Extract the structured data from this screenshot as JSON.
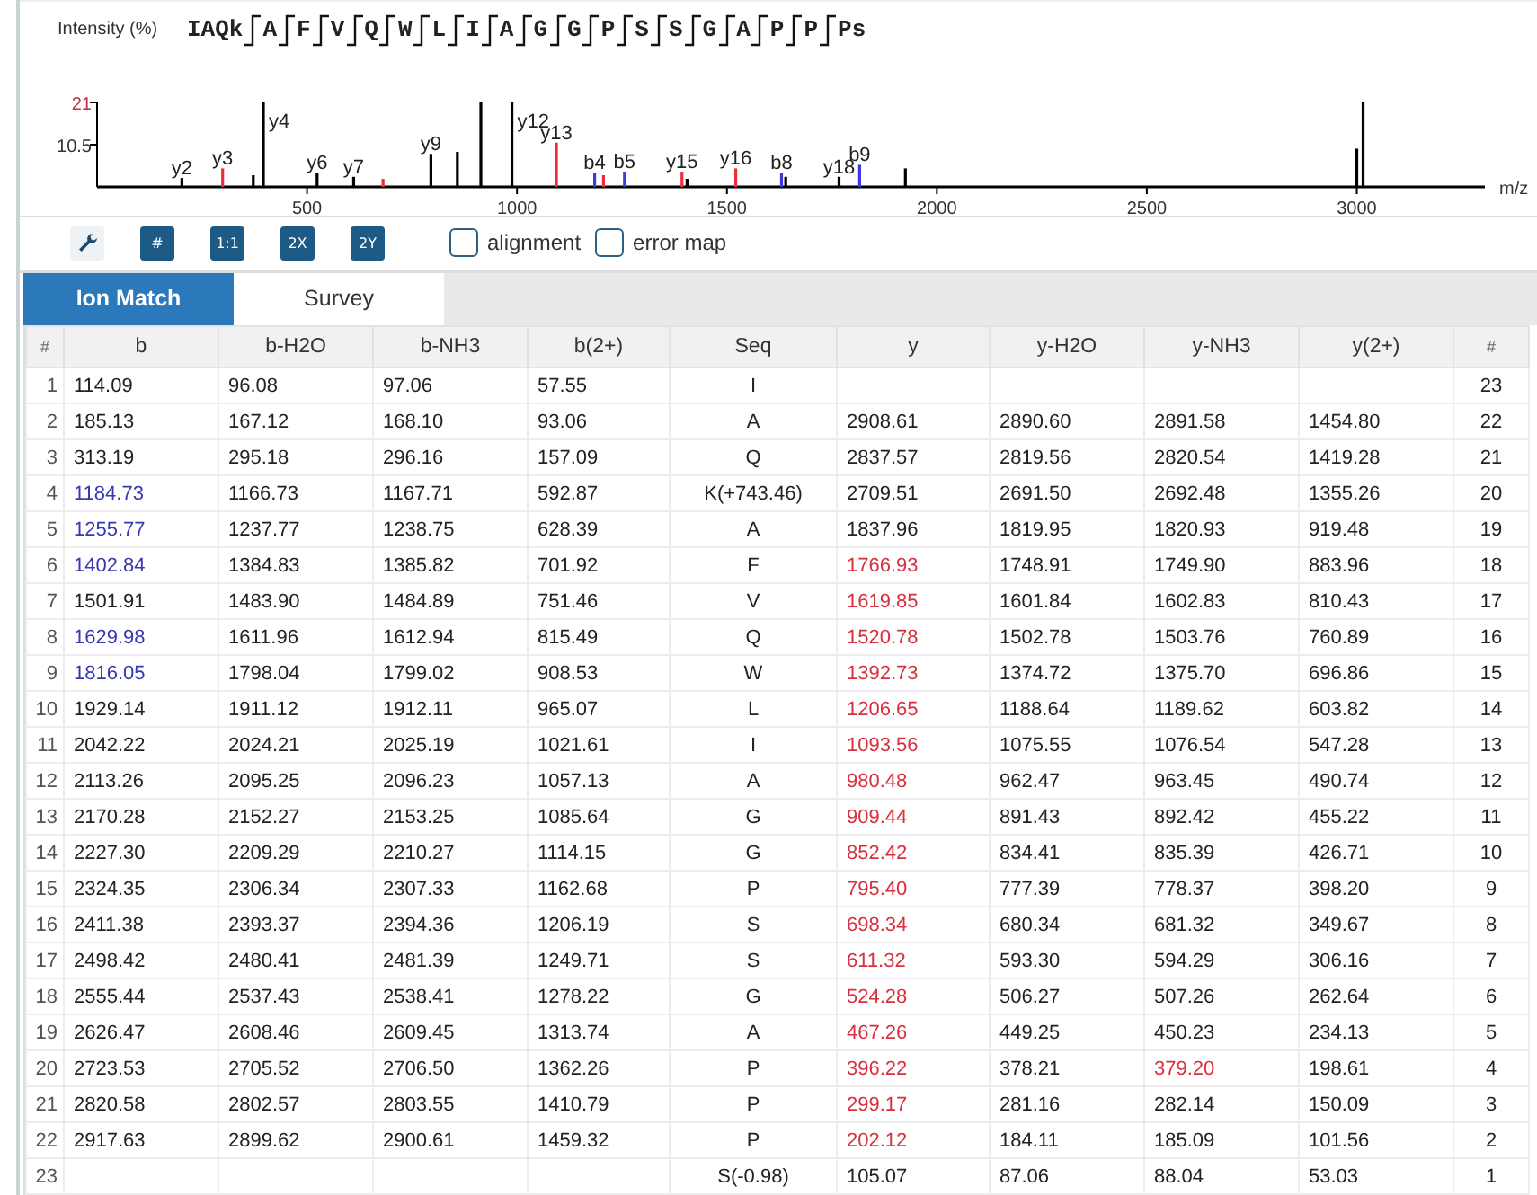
{
  "spectrum": {
    "sequence": [
      {
        "text": "IAQk",
        "break_after": true
      },
      {
        "text": "A",
        "break_after": true
      },
      {
        "text": "F",
        "break_after": true
      },
      {
        "text": "V",
        "break_after": true
      },
      {
        "text": "Q",
        "break_after": true
      },
      {
        "text": "W",
        "break_after": true
      },
      {
        "text": "L",
        "break_after": true
      },
      {
        "text": "I",
        "break_after": true
      },
      {
        "text": "A",
        "break_after": true
      },
      {
        "text": "G",
        "break_after": true
      },
      {
        "text": "G",
        "break_after": true
      },
      {
        "text": "P",
        "break_after": true
      },
      {
        "text": "S",
        "break_after": true
      },
      {
        "text": "S",
        "break_after": true
      },
      {
        "text": "G",
        "break_after": true
      },
      {
        "text": "A",
        "break_after": true
      },
      {
        "text": "P",
        "break_after": true
      },
      {
        "text": "P",
        "break_after": true
      },
      {
        "text": "Ps",
        "break_after": false
      }
    ],
    "chart_data": {
      "type": "bar",
      "ylabel": "Intensity (%)",
      "xlabel": "m/z",
      "xlim": [
        0,
        3305
      ],
      "ylim": [
        0,
        21
      ],
      "xticks": [
        500,
        1000,
        1500,
        2000,
        2500,
        3000
      ],
      "yticks": [
        10.5,
        21
      ],
      "x": [
        202,
        299,
        372,
        396,
        524,
        611,
        681,
        795,
        858,
        914,
        988,
        1094,
        1185,
        1206,
        1256,
        1393,
        1405,
        1521,
        1630,
        1640,
        1767,
        1816,
        1925,
        3000,
        3015
      ],
      "series": [
        {
          "color": "#000000",
          "values": [
            2.2,
            null,
            2.9,
            21,
            3.5,
            2.5,
            null,
            8.2,
            8.7,
            21,
            21,
            null,
            null,
            null,
            null,
            null,
            2.0,
            null,
            null,
            2.5,
            2.5,
            null,
            4.6,
            9.5,
            21
          ]
        },
        {
          "color": "#e8303a",
          "values": [
            null,
            4.6,
            null,
            null,
            null,
            null,
            2.0,
            null,
            null,
            null,
            null,
            11,
            null,
            2.9,
            null,
            3.8,
            null,
            4.6,
            null,
            null,
            null,
            null,
            null,
            null,
            null
          ]
        },
        {
          "color": "#3a3ae0",
          "values": [
            null,
            null,
            null,
            null,
            null,
            null,
            null,
            null,
            null,
            null,
            null,
            null,
            3.5,
            null,
            3.8,
            null,
            null,
            null,
            3.5,
            null,
            null,
            5.5,
            null,
            null,
            null
          ]
        }
      ],
      "annotations": [
        {
          "x": 202,
          "y": 2.2,
          "text": "y2"
        },
        {
          "x": 299,
          "y": 4.6,
          "text": "y3"
        },
        {
          "x": 396,
          "y": 21,
          "text": "y4"
        },
        {
          "x": 524,
          "y": 3.5,
          "text": "y6"
        },
        {
          "x": 611,
          "y": 2.5,
          "text": "y7"
        },
        {
          "x": 795,
          "y": 8.2,
          "text": "y9"
        },
        {
          "x": 988,
          "y": 21,
          "text": "y12"
        },
        {
          "x": 1094,
          "y": 11,
          "text": "y13"
        },
        {
          "x": 1185,
          "y": 3.5,
          "text": "b4"
        },
        {
          "x": 1256,
          "y": 3.8,
          "text": "b5"
        },
        {
          "x": 1393,
          "y": 3.8,
          "text": "y15"
        },
        {
          "x": 1521,
          "y": 4.6,
          "text": "y16"
        },
        {
          "x": 1630,
          "y": 3.5,
          "text": "b8"
        },
        {
          "x": 1767,
          "y": 2.5,
          "text": "y18"
        },
        {
          "x": 1816,
          "y": 5.5,
          "text": "b9"
        }
      ]
    }
  },
  "toolbar": {
    "buttons": [
      {
        "kind": "wrench"
      },
      {
        "kind": "text",
        "label": "#"
      },
      {
        "kind": "text",
        "label": "1:1"
      },
      {
        "kind": "text",
        "label": "2X"
      },
      {
        "kind": "text",
        "label": "2Y"
      }
    ],
    "checkboxes": [
      {
        "label": "alignment",
        "checked": false
      },
      {
        "label": "error map",
        "checked": false
      }
    ]
  },
  "tabs": [
    {
      "label": "Ion Match",
      "selected": true
    },
    {
      "label": "Survey",
      "selected": false
    }
  ],
  "table": {
    "columns": [
      "#",
      "b",
      "b-H2O",
      "b-NH3",
      "b(2+)",
      "Seq",
      "y",
      "y-H2O",
      "y-NH3",
      "y(2+)",
      "#"
    ],
    "rows": [
      {
        "cells": [
          "1",
          "114.09",
          "96.08",
          "97.06",
          "57.55",
          "I",
          null,
          null,
          null,
          null,
          "23"
        ],
        "b_matched": false
      },
      {
        "cells": [
          "2",
          "185.13",
          "167.12",
          "168.10",
          "93.06",
          "A",
          "2908.61",
          "2890.60",
          "2891.58",
          "1454.80",
          "22"
        ],
        "b_matched": false,
        "y_matched": false,
        "y_nh3_matched": false
      },
      {
        "cells": [
          "3",
          "313.19",
          "295.18",
          "296.16",
          "157.09",
          "Q",
          "2837.57",
          "2819.56",
          "2820.54",
          "1419.28",
          "21"
        ],
        "b_matched": false,
        "y_matched": false,
        "y_nh3_matched": false
      },
      {
        "cells": [
          "4",
          "1184.73",
          "1166.73",
          "1167.71",
          "592.87",
          "K(+743.46)",
          "2709.51",
          "2691.50",
          "2692.48",
          "1355.26",
          "20"
        ],
        "b_matched": true,
        "y_matched": false,
        "y_nh3_matched": false
      },
      {
        "cells": [
          "5",
          "1255.77",
          "1237.77",
          "1238.75",
          "628.39",
          "A",
          "1837.96",
          "1819.95",
          "1820.93",
          "919.48",
          "19"
        ],
        "b_matched": true,
        "y_matched": false,
        "y_nh3_matched": false
      },
      {
        "cells": [
          "6",
          "1402.84",
          "1384.83",
          "1385.82",
          "701.92",
          "F",
          "1766.93",
          "1748.91",
          "1749.90",
          "883.96",
          "18"
        ],
        "b_matched": true,
        "y_matched": true,
        "y_nh3_matched": false
      },
      {
        "cells": [
          "7",
          "1501.91",
          "1483.90",
          "1484.89",
          "751.46",
          "V",
          "1619.85",
          "1601.84",
          "1602.83",
          "810.43",
          "17"
        ],
        "b_matched": false,
        "y_matched": true,
        "y_nh3_matched": false
      },
      {
        "cells": [
          "8",
          "1629.98",
          "1611.96",
          "1612.94",
          "815.49",
          "Q",
          "1520.78",
          "1502.78",
          "1503.76",
          "760.89",
          "16"
        ],
        "b_matched": true,
        "y_matched": true,
        "y_nh3_matched": false
      },
      {
        "cells": [
          "9",
          "1816.05",
          "1798.04",
          "1799.02",
          "908.53",
          "W",
          "1392.73",
          "1374.72",
          "1375.70",
          "696.86",
          "15"
        ],
        "b_matched": true,
        "y_matched": true,
        "y_nh3_matched": false
      },
      {
        "cells": [
          "10",
          "1929.14",
          "1911.12",
          "1912.11",
          "965.07",
          "L",
          "1206.65",
          "1188.64",
          "1189.62",
          "603.82",
          "14"
        ],
        "b_matched": false,
        "y_matched": true,
        "y_nh3_matched": false
      },
      {
        "cells": [
          "11",
          "2042.22",
          "2024.21",
          "2025.19",
          "1021.61",
          "I",
          "1093.56",
          "1075.55",
          "1076.54",
          "547.28",
          "13"
        ],
        "b_matched": false,
        "y_matched": true,
        "y_nh3_matched": false
      },
      {
        "cells": [
          "12",
          "2113.26",
          "2095.25",
          "2096.23",
          "1057.13",
          "A",
          "980.48",
          "962.47",
          "963.45",
          "490.74",
          "12"
        ],
        "b_matched": false,
        "y_matched": true,
        "y_nh3_matched": false
      },
      {
        "cells": [
          "13",
          "2170.28",
          "2152.27",
          "2153.25",
          "1085.64",
          "G",
          "909.44",
          "891.43",
          "892.42",
          "455.22",
          "11"
        ],
        "b_matched": false,
        "y_matched": true,
        "y_nh3_matched": false
      },
      {
        "cells": [
          "14",
          "2227.30",
          "2209.29",
          "2210.27",
          "1114.15",
          "G",
          "852.42",
          "834.41",
          "835.39",
          "426.71",
          "10"
        ],
        "b_matched": false,
        "y_matched": true,
        "y_nh3_matched": false
      },
      {
        "cells": [
          "15",
          "2324.35",
          "2306.34",
          "2307.33",
          "1162.68",
          "P",
          "795.40",
          "777.39",
          "778.37",
          "398.20",
          "9"
        ],
        "b_matched": false,
        "y_matched": true,
        "y_nh3_matched": false
      },
      {
        "cells": [
          "16",
          "2411.38",
          "2393.37",
          "2394.36",
          "1206.19",
          "S",
          "698.34",
          "680.34",
          "681.32",
          "349.67",
          "8"
        ],
        "b_matched": false,
        "y_matched": true,
        "y_nh3_matched": false
      },
      {
        "cells": [
          "17",
          "2498.42",
          "2480.41",
          "2481.39",
          "1249.71",
          "S",
          "611.32",
          "593.30",
          "594.29",
          "306.16",
          "7"
        ],
        "b_matched": false,
        "y_matched": true,
        "y_nh3_matched": false
      },
      {
        "cells": [
          "18",
          "2555.44",
          "2537.43",
          "2538.41",
          "1278.22",
          "G",
          "524.28",
          "506.27",
          "507.26",
          "262.64",
          "6"
        ],
        "b_matched": false,
        "y_matched": true,
        "y_nh3_matched": false
      },
      {
        "cells": [
          "19",
          "2626.47",
          "2608.46",
          "2609.45",
          "1313.74",
          "A",
          "467.26",
          "449.25",
          "450.23",
          "234.13",
          "5"
        ],
        "b_matched": false,
        "y_matched": true,
        "y_nh3_matched": false
      },
      {
        "cells": [
          "20",
          "2723.53",
          "2705.52",
          "2706.50",
          "1362.26",
          "P",
          "396.22",
          "378.21",
          "379.20",
          "198.61",
          "4"
        ],
        "b_matched": false,
        "y_matched": true,
        "y_nh3_matched": true
      },
      {
        "cells": [
          "21",
          "2820.58",
          "2802.57",
          "2803.55",
          "1410.79",
          "P",
          "299.17",
          "281.16",
          "282.14",
          "150.09",
          "3"
        ],
        "b_matched": false,
        "y_matched": true,
        "y_nh3_matched": false
      },
      {
        "cells": [
          "22",
          "2917.63",
          "2899.62",
          "2900.61",
          "1459.32",
          "P",
          "202.12",
          "184.11",
          "185.09",
          "101.56",
          "2"
        ],
        "b_matched": false,
        "y_matched": true,
        "y_nh3_matched": false
      },
      {
        "cells": [
          "23",
          null,
          null,
          null,
          null,
          "S(-0.98)",
          "105.07",
          "87.06",
          "88.04",
          "53.03",
          "1"
        ],
        "y_matched": false,
        "y_nh3_matched": false
      }
    ]
  }
}
